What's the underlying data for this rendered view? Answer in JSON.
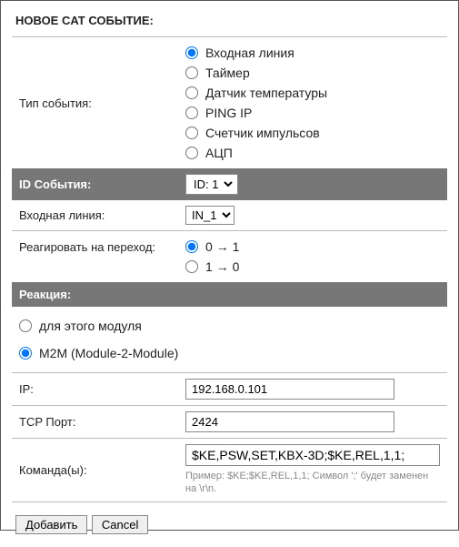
{
  "title": "НОВОЕ CAT СОБЫТИЕ:",
  "event_type": {
    "label": "Тип события:",
    "options": [
      "Входная линия",
      "Таймер",
      "Датчик температуры",
      "PING IP",
      "Счетчик импульсов",
      "АЦП"
    ],
    "selected_index": 0
  },
  "event_id": {
    "label": "ID События:",
    "selected": "ID: 1"
  },
  "input_line": {
    "label": "Входная линия:",
    "selected": "IN_1"
  },
  "transition": {
    "label": "Реагировать на переход:",
    "options": [
      "0 → 1",
      "1 → 0"
    ],
    "selected_index": 0
  },
  "reaction": {
    "header": "Реакция:",
    "options": [
      "для этого модуля",
      "M2M (Module-2-Module)"
    ],
    "selected_index": 1
  },
  "ip": {
    "label": "IP:",
    "value": "192.168.0.101"
  },
  "tcp_port": {
    "label": "TCP Порт:",
    "value": "2424"
  },
  "commands": {
    "label": "Команда(ы):",
    "value": "$KE,PSW,SET,KBX-3D;$KE,REL,1,1;",
    "hint": "Пример: $KE;$KE,REL,1,1; Символ ';' будет заменен на \\r\\n."
  },
  "buttons": {
    "add": "Добавить",
    "cancel": "Cancel"
  }
}
